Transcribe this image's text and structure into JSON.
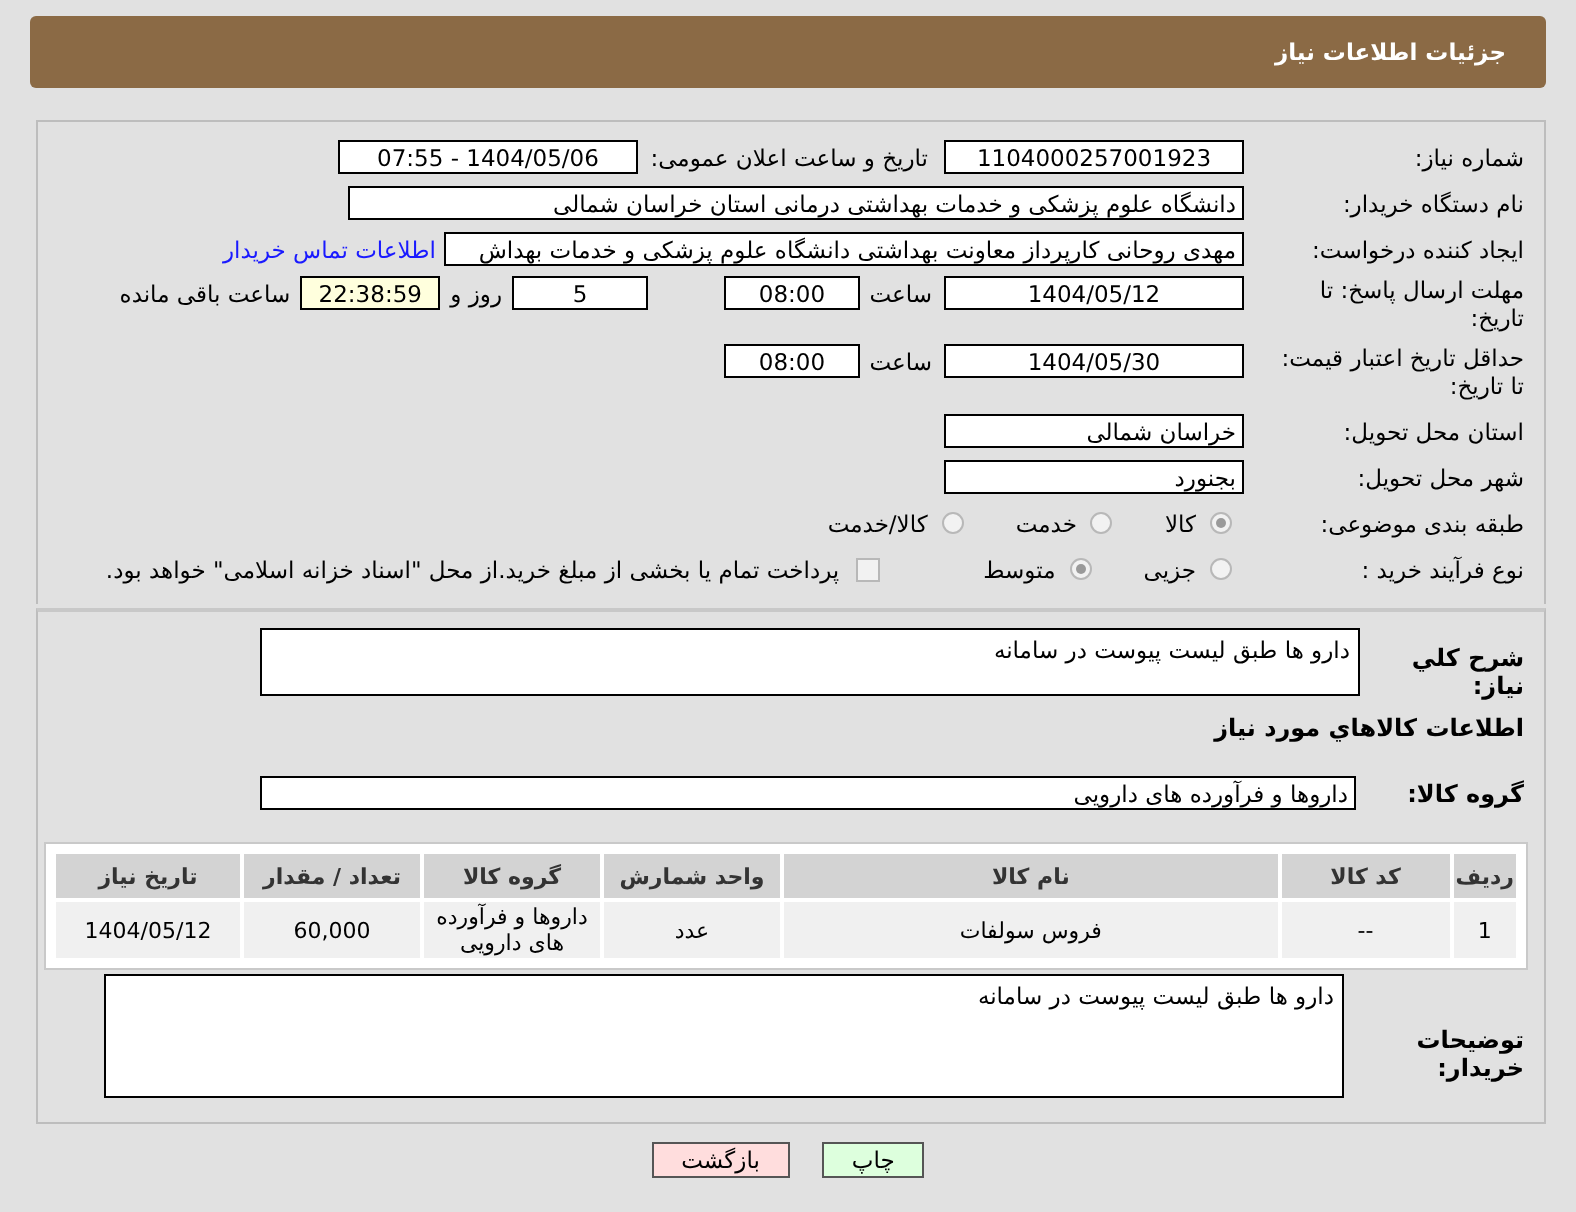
{
  "header": {
    "title": "جزئیات اطلاعات نیاز"
  },
  "details": {
    "need_number": {
      "label": "شماره نیاز:",
      "value": "1104000257001923"
    },
    "announce": {
      "label": "تاریخ و ساعت اعلان عمومی:",
      "value": "1404/05/06 - 07:55"
    },
    "buyer_org": {
      "label": "نام دستگاه خریدار:",
      "value": "دانشگاه علوم پزشکی و خدمات بهداشتی درمانی استان خراسان شمالی"
    },
    "creator": {
      "label": "ایجاد کننده درخواست:",
      "value": "مهدی روحانی کارپرداز معاونت بهداشتی دانشگاه علوم پزشکی و خدمات بهداش",
      "link": "اطلاعات تماس خریدار"
    },
    "deadline": {
      "label": "مهلت ارسال پاسخ: تا تاریخ:",
      "date": "1404/05/12",
      "time_label": "ساعت",
      "time": "08:00",
      "days": "5",
      "days_label": "روز و",
      "remaining": "22:38:59",
      "remaining_label": "ساعت باقی مانده"
    },
    "validity": {
      "label": "حداقل تاریخ اعتبار قیمت: تا تاریخ:",
      "date": "1404/05/30",
      "time_label": "ساعت",
      "time": "08:00"
    },
    "province": {
      "label": "استان محل تحویل:",
      "value": "خراسان شمالی"
    },
    "city": {
      "label": "شهر محل تحویل:",
      "value": "بجنورد"
    },
    "category": {
      "label": "طبقه بندی موضوعی:",
      "options": [
        {
          "label": "کالا",
          "selected": true
        },
        {
          "label": "خدمت",
          "selected": false
        },
        {
          "label": "کالا/خدمت",
          "selected": false
        }
      ]
    },
    "process": {
      "label": "نوع فرآیند خرید :",
      "options": [
        {
          "label": "جزیی",
          "selected": false
        },
        {
          "label": "متوسط",
          "selected": true
        }
      ],
      "treasury": {
        "label": "پرداخت تمام یا بخشی از مبلغ خرید.از محل \"اسناد خزانه اسلامی\" خواهد بود.",
        "checked": false
      }
    }
  },
  "summary": {
    "label": "شرح کلي نیاز:",
    "value": "دارو ها طبق لیست پیوست در سامانه"
  },
  "goods_title": "اطلاعات کالاهاي مورد نیاز",
  "goods_group": {
    "label": "گروه کالا:",
    "value": "داروها و فرآورده های دارویی"
  },
  "table": {
    "columns": [
      "ردیف",
      "کد کالا",
      "نام کالا",
      "واحد شمارش",
      "گروه کالا",
      "تعداد / مقدار",
      "تاریخ نیاز"
    ],
    "rows": [
      [
        "1",
        "--",
        "فروس سولفات",
        "عدد",
        "داروها و فرآورده های دارویی",
        "60,000",
        "1404/05/12"
      ]
    ]
  },
  "buyer_notes": {
    "label": "توضیحات خریدار:",
    "value": "دارو ها طبق لیست پیوست در سامانه"
  },
  "buttons": [
    {
      "label": "چاپ",
      "kind": "print"
    },
    {
      "label": "بازگشت",
      "kind": "back"
    }
  ]
}
